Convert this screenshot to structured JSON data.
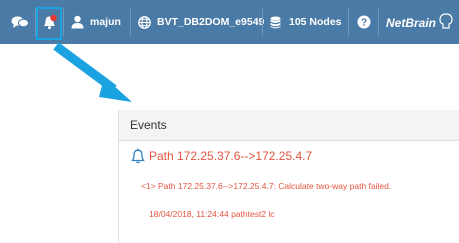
{
  "colors": {
    "topbar": "#4a7aa6",
    "highlight": "#1aa3e0",
    "event_text": "#e2553f",
    "bell": "#2e7fc2"
  },
  "topbar": {
    "chat_icon": "chat-bubbles-icon",
    "alert_icon": "bell-alert-icon",
    "user": {
      "icon": "user-icon",
      "name": "majun"
    },
    "domain": {
      "icon": "globe-icon",
      "name": "BVT_DB2DOM_e9549"
    },
    "nodes": {
      "icon": "database-icon",
      "label": "105 Nodes"
    },
    "help_icon": "help-icon",
    "logo": "NetBrain"
  },
  "events": {
    "title": "Events",
    "items": [
      {
        "icon": "bell-icon",
        "path": "Path 172.25.37.6-->172.25.4.7",
        "message": "<1> Path 172.25.37.6-->172.25.4.7: Calculate two-way path failed.",
        "timestamp": "18/04/2018, 11:24:44 pathtest2 lc"
      }
    ]
  }
}
